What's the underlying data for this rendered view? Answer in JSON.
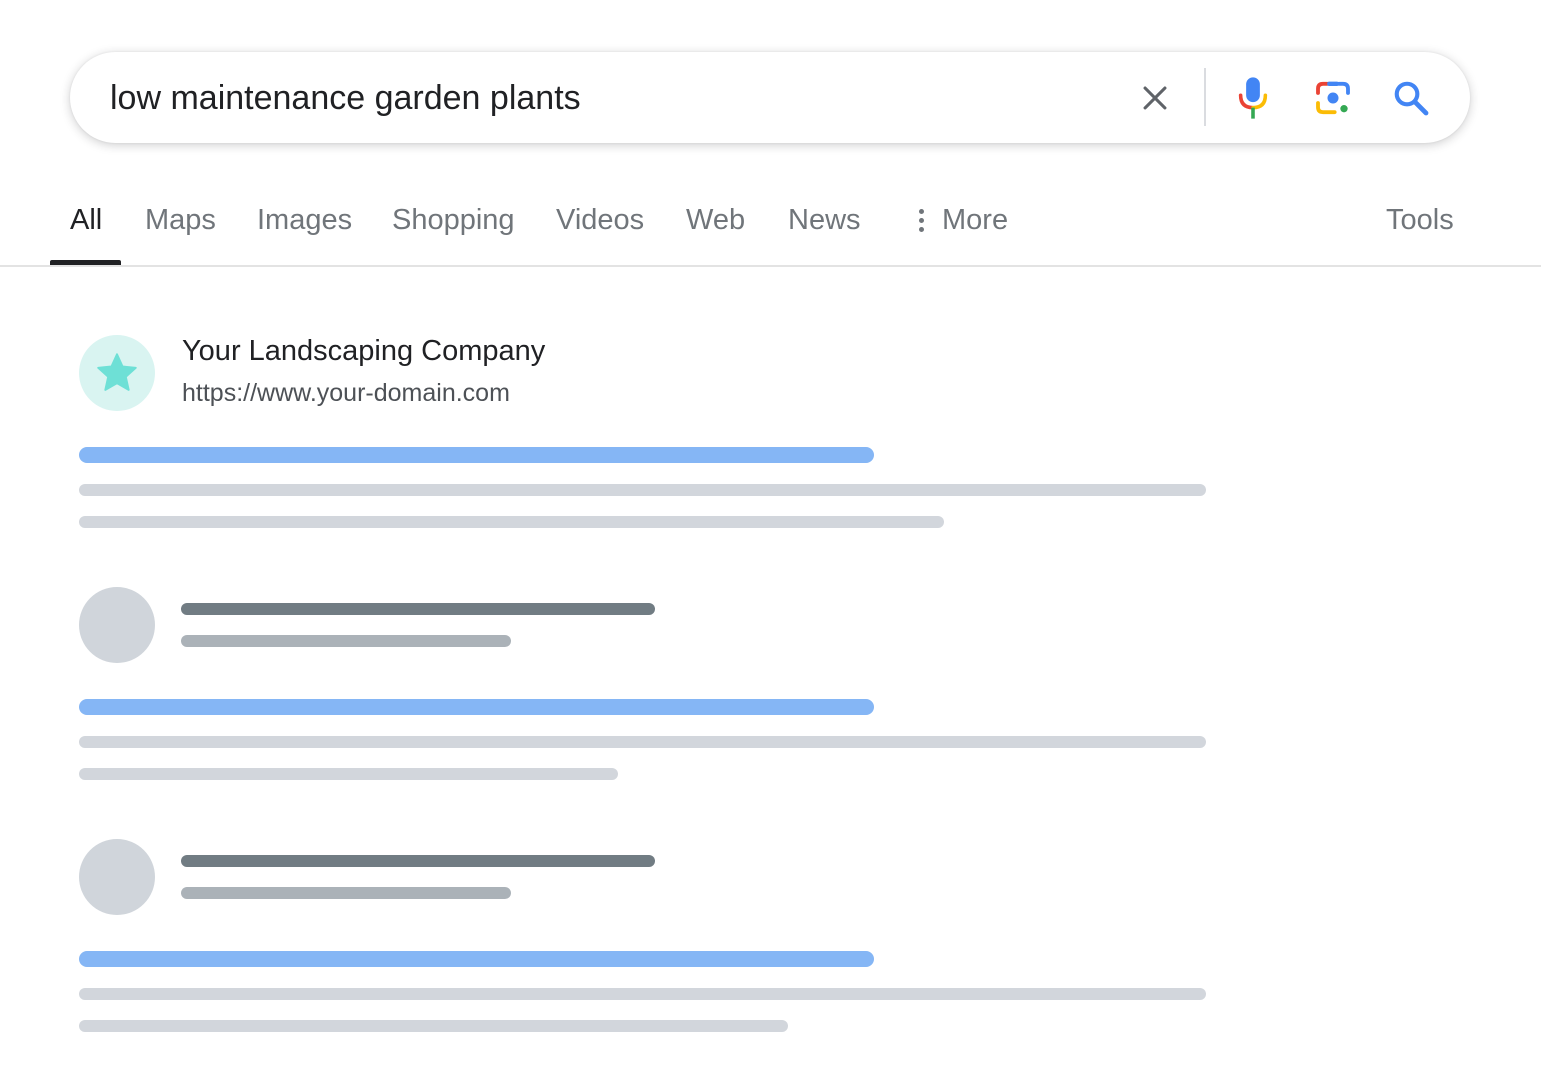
{
  "search": {
    "query": "low maintenance garden plants",
    "clear_icon": "close-icon",
    "voice_icon": "microphone-icon",
    "lens_icon": "camera-lens-icon",
    "submit_icon": "search-icon"
  },
  "tabs": [
    {
      "label": "All",
      "active": true
    },
    {
      "label": "Maps"
    },
    {
      "label": "Images"
    },
    {
      "label": "Shopping"
    },
    {
      "label": "Videos"
    },
    {
      "label": "Web"
    },
    {
      "label": "News"
    }
  ],
  "more_tab": {
    "label": "More",
    "icon": "vertical-dots-icon"
  },
  "tools_tab": {
    "label": "Tools"
  },
  "results": [
    {
      "site_name": "Your Landscaping Company",
      "url": "https://www.your-domain.com",
      "favicon_icon": "star-icon"
    }
  ],
  "colors": {
    "google_blue": "#4285F4",
    "google_red": "#EA4335",
    "google_yellow": "#FBBC05",
    "google_green": "#34A853",
    "brand_star": "#6ee0d6",
    "title_placeholder": "#85b6f5",
    "snippet_placeholder": "#d2d6dc"
  }
}
